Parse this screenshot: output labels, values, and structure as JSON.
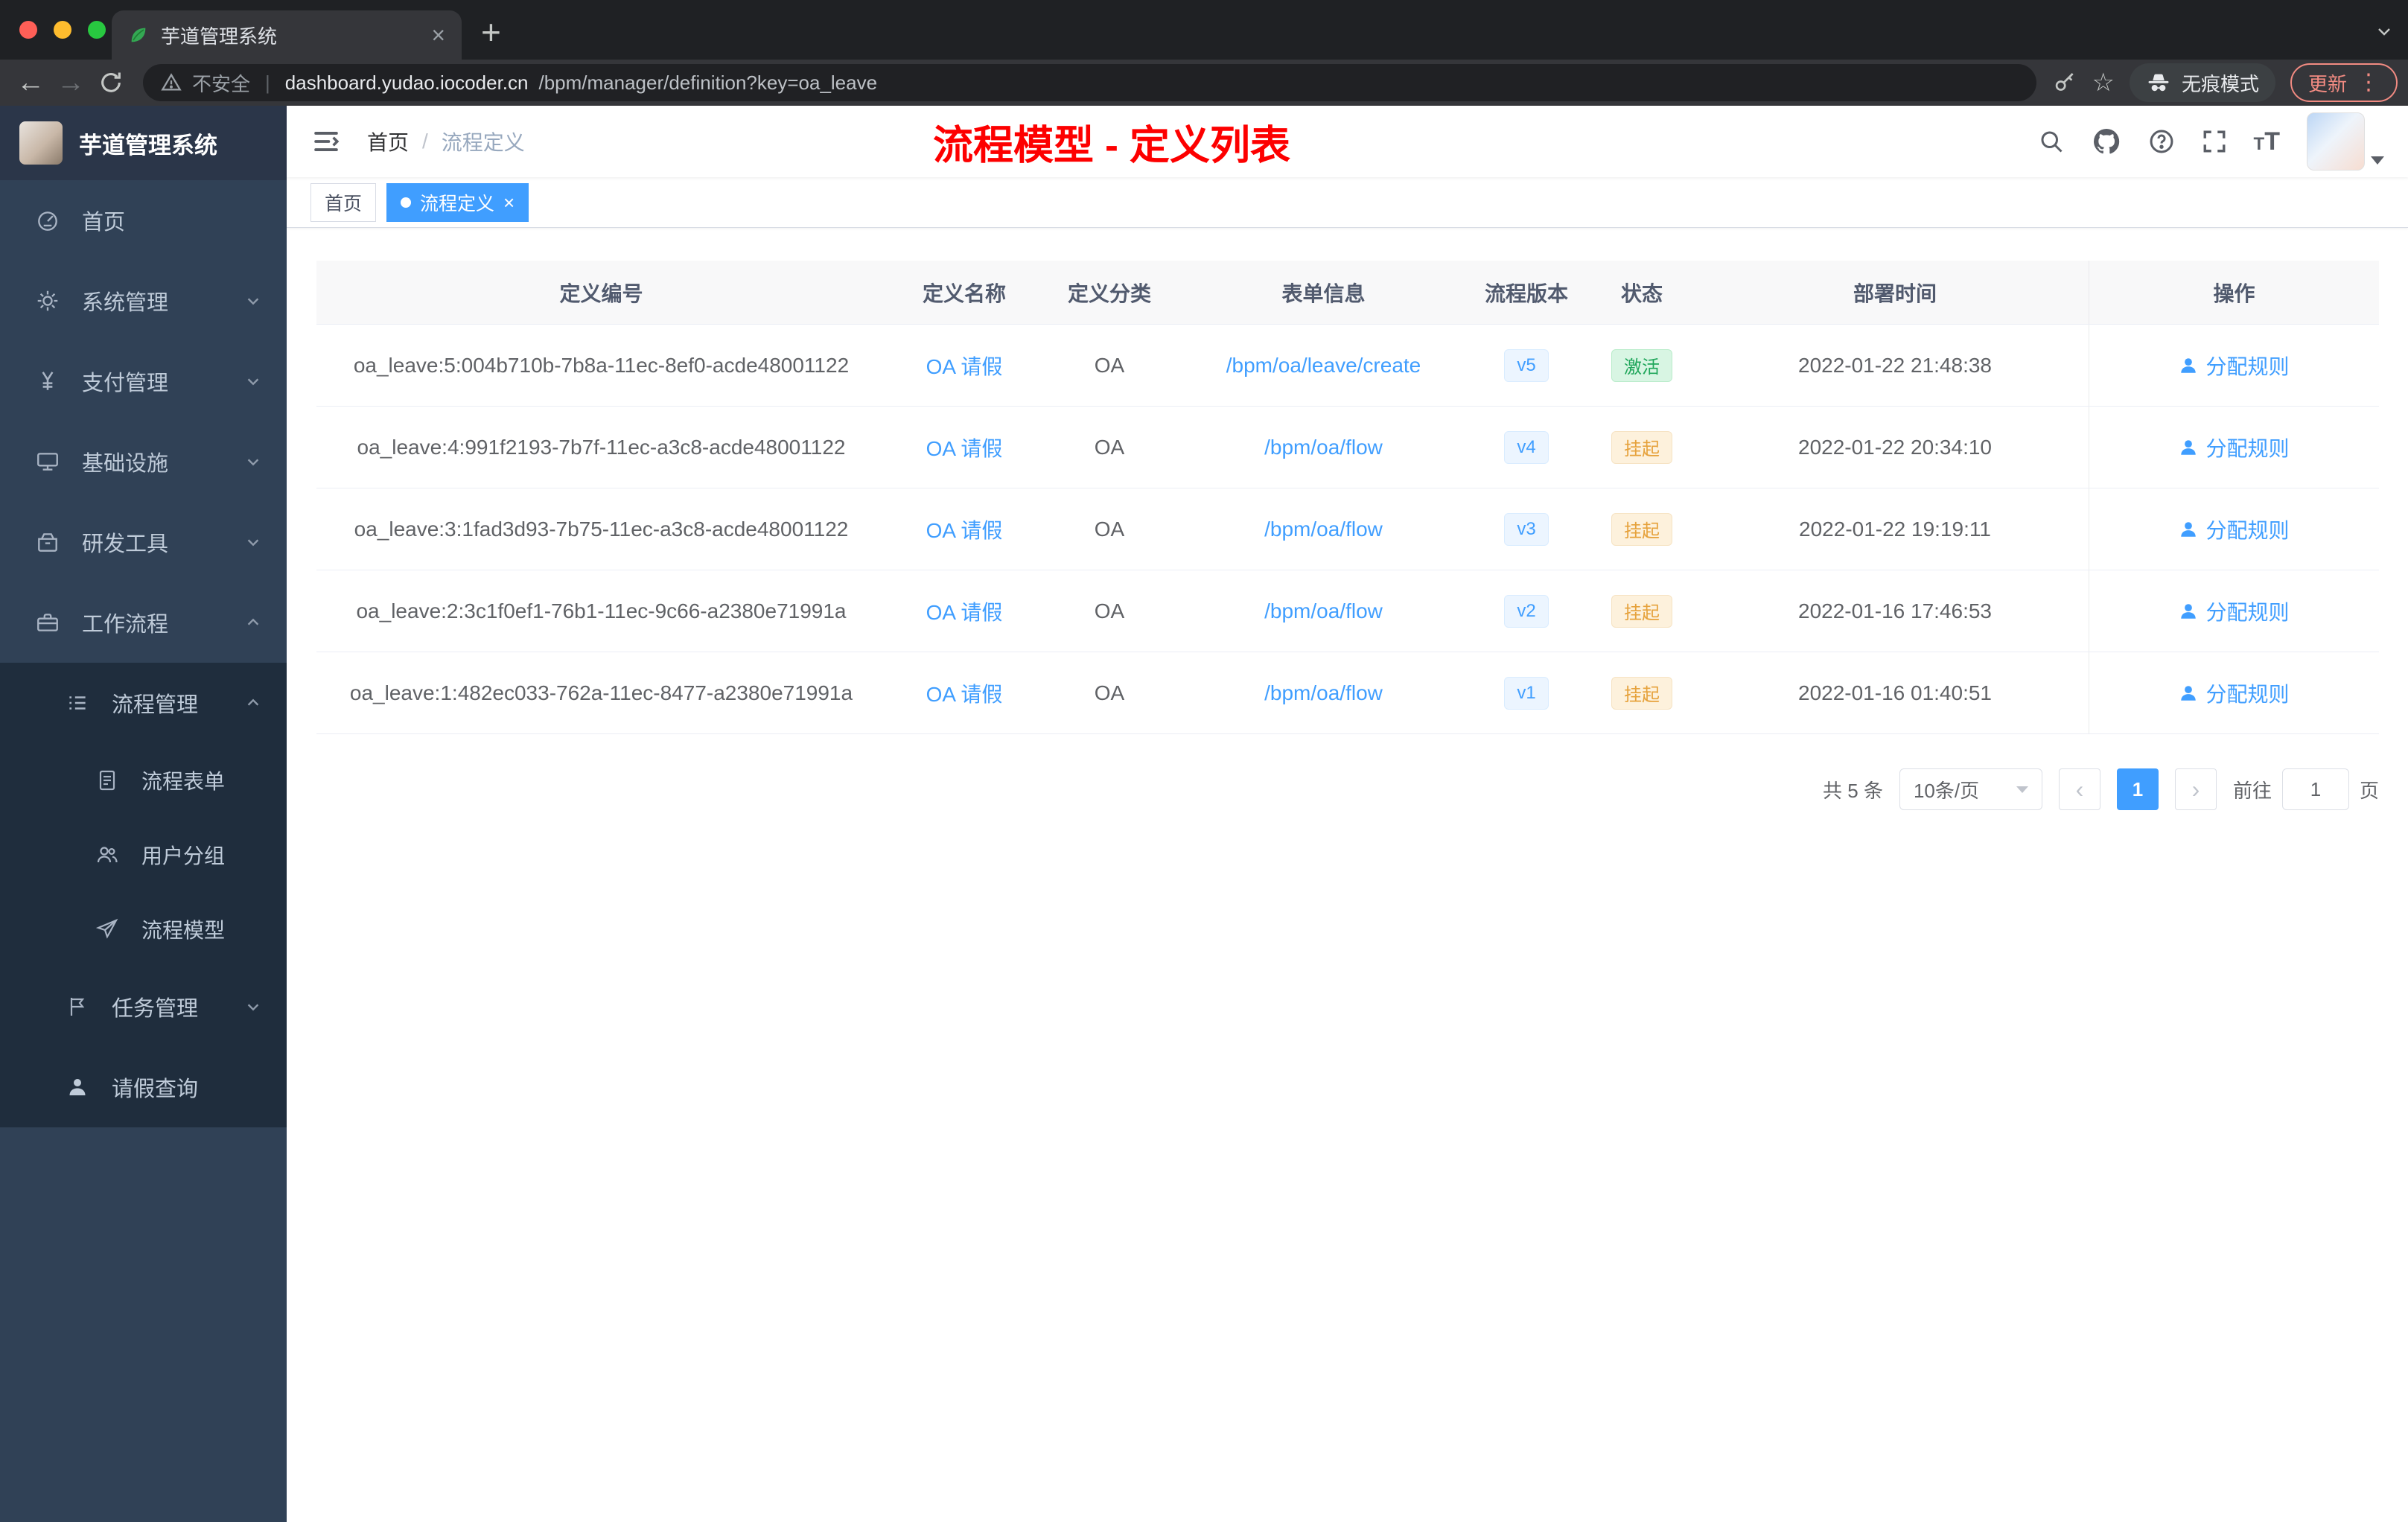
{
  "browser": {
    "tab_title": "芋道管理系统",
    "security_label": "不安全",
    "url_host": "dashboard.yudao.iocoder.cn",
    "url_path": "/bpm/manager/definition?key=oa_leave",
    "incognito_label": "无痕模式",
    "update_label": "更新"
  },
  "sidebar": {
    "logo_title": "芋道管理系统",
    "items": [
      {
        "label": "首页"
      },
      {
        "label": "系统管理"
      },
      {
        "label": "支付管理"
      },
      {
        "label": "基础设施"
      },
      {
        "label": "研发工具"
      },
      {
        "label": "工作流程"
      },
      {
        "label": "流程管理"
      },
      {
        "label": "流程表单"
      },
      {
        "label": "用户分组"
      },
      {
        "label": "流程模型"
      },
      {
        "label": "任务管理"
      },
      {
        "label": "请假查询"
      }
    ]
  },
  "header": {
    "breadcrumb_home": "首页",
    "breadcrumb_current": "流程定义",
    "annotation": "流程模型 - 定义列表"
  },
  "tags": [
    {
      "label": "首页"
    },
    {
      "label": "流程定义"
    }
  ],
  "table": {
    "columns": [
      "定义编号",
      "定义名称",
      "定义分类",
      "表单信息",
      "流程版本",
      "状态",
      "部署时间",
      "操作"
    ],
    "rows": [
      {
        "id": "oa_leave:5:004b710b-7b8a-11ec-8ef0-acde48001122",
        "name": "OA 请假",
        "category": "OA",
        "form": "/bpm/oa/leave/create",
        "version": "v5",
        "status": "激活",
        "status_type": "success",
        "time": "2022-01-22 21:48:38",
        "action": "分配规则"
      },
      {
        "id": "oa_leave:4:991f2193-7b7f-11ec-a3c8-acde48001122",
        "name": "OA 请假",
        "category": "OA",
        "form": "/bpm/oa/flow",
        "version": "v4",
        "status": "挂起",
        "status_type": "warning",
        "time": "2022-01-22 20:34:10",
        "action": "分配规则"
      },
      {
        "id": "oa_leave:3:1fad3d93-7b75-11ec-a3c8-acde48001122",
        "name": "OA 请假",
        "category": "OA",
        "form": "/bpm/oa/flow",
        "version": "v3",
        "status": "挂起",
        "status_type": "warning",
        "time": "2022-01-22 19:19:11",
        "action": "分配规则"
      },
      {
        "id": "oa_leave:2:3c1f0ef1-76b1-11ec-9c66-a2380e71991a",
        "name": "OA 请假",
        "category": "OA",
        "form": "/bpm/oa/flow",
        "version": "v2",
        "status": "挂起",
        "status_type": "warning",
        "time": "2022-01-16 17:46:53",
        "action": "分配规则"
      },
      {
        "id": "oa_leave:1:482ec033-762a-11ec-8477-a2380e71991a",
        "name": "OA 请假",
        "category": "OA",
        "form": "/bpm/oa/flow",
        "version": "v1",
        "status": "挂起",
        "status_type": "warning",
        "time": "2022-01-16 01:40:51",
        "action": "分配规则"
      }
    ]
  },
  "pagination": {
    "total_label": "共 5 条",
    "page_size": "10条/页",
    "current_page": "1",
    "goto_label": "前往",
    "goto_value": "1",
    "page_unit": "页"
  },
  "colors": {
    "accent": "#409eff",
    "success_tag": "#1fa65a",
    "warning_tag": "#e6a23c",
    "annotation_red": "#fd0000",
    "sidebar_bg": "#304156",
    "submenu_bg": "#1f2d3d"
  }
}
